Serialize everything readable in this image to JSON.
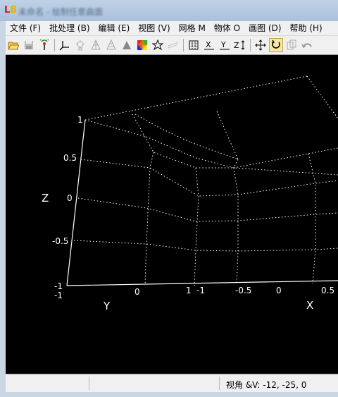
{
  "window": {
    "title": "未命名 - 绘制任意曲面"
  },
  "menu": [
    {
      "label": "文件 (F)"
    },
    {
      "label": "批处理 (B)"
    },
    {
      "label": "编辑 (E)"
    },
    {
      "label": "视图 (V)"
    },
    {
      "label": "网格 M"
    },
    {
      "label": "物体 O"
    },
    {
      "label": "画图 (D)"
    },
    {
      "label": "帮助 (H)"
    }
  ],
  "toolbar": {
    "open_icon": "folder-open-icon",
    "save_icon": "save-icon",
    "reset_icon": "antenna-icon",
    "rotate_axes_icon": "axes-icon",
    "light_icon": "light-icon",
    "wire_icon": "wireframe-icon",
    "mesh_icon": "mesh-icon",
    "solid_icon": "solid-icon",
    "color_icon": "colormap-icon",
    "star_icon": "star-icon",
    "lines_icon": "lines-icon",
    "grid_icon": "grid-icon",
    "x_axis_icon": "x-axis-icon",
    "y_axis_icon": "y-axis-icon",
    "z_axis_icon": "z-axis-icon",
    "pan_icon": "pan-icon",
    "rotate_icon": "rotate-icon",
    "rotate_active": true,
    "copy_icon": "copy-icon",
    "undo_icon": "undo-icon"
  },
  "plot": {
    "z_axis_label": "Z",
    "y_axis_label": "Y",
    "x_axis_label": "X",
    "z_ticks": [
      "1",
      "0.5",
      "0",
      "-0.5",
      "-1"
    ],
    "y_ticks": [
      "-1",
      "0",
      "1"
    ],
    "x_ticks": [
      "-1",
      "-0.5",
      "0",
      "0.5"
    ]
  },
  "status": {
    "view_angle": "视角 &V: -12, -25, 0"
  }
}
